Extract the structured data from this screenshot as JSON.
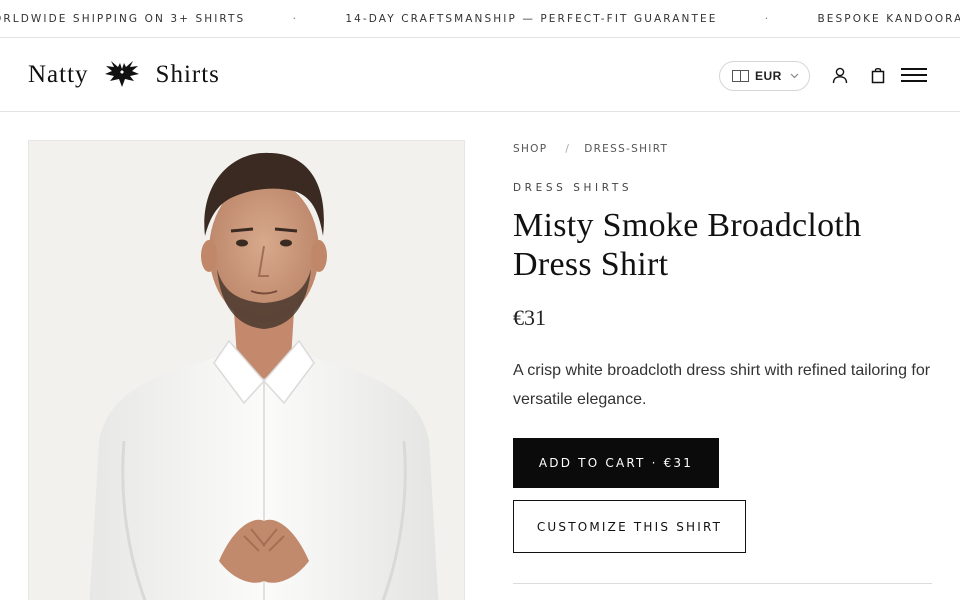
{
  "announcement": {
    "messages": [
      "ORLDWIDE SHIPPING ON 3+ SHIRTS",
      "14-DAY CRAFTSMANSHIP — PERFECT-FIT GUARANTEE",
      "BESPOKE KANDOORA COLLECTION"
    ],
    "separator": "·"
  },
  "header": {
    "logo_left": "Natty",
    "logo_right": "Shirts",
    "currency": "EUR",
    "icons": [
      "flag-icon",
      "chevron-down-icon",
      "account-icon",
      "cart-icon",
      "menu-icon"
    ]
  },
  "product": {
    "breadcrumb": [
      "SHOP",
      "DRESS-SHIRT"
    ],
    "breadcrumb_separator": "/",
    "category": "DRESS SHIRTS",
    "title": "Misty Smoke Broadcloth Dress Shirt",
    "price": "€31",
    "description": "A crisp white broadcloth dress shirt with refined tailoring for versatile elegance.",
    "add_to_cart_label": "ADD TO CART · €31",
    "customize_label": "CUSTOMIZE THIS SHIRT"
  },
  "colors": {
    "primary_button": "#0b0b0b",
    "text": "#1a1a1a",
    "border": "#e3e3e3"
  }
}
